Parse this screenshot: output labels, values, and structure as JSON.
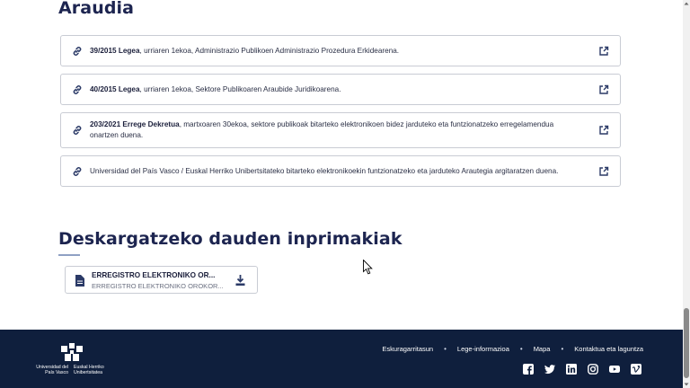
{
  "sections": {
    "regulations_title": "Araudia",
    "forms_title": "Deskargatzeko dauden inprimakiak"
  },
  "laws": [
    {
      "bold": "39/2015 Legea",
      "rest": ", urriaren 1ekoa, Administrazio Publikoen Administrazio Prozedura Erkidearena."
    },
    {
      "bold": "40/2015 Legea",
      "rest": ", urriaren 1ekoa, Sektore Publikoaren Araubide Juridikoarena."
    },
    {
      "bold": "203/2021 Errege Dekretua",
      "rest": ", martxoaren 30ekoa, sektore publikoak bitarteko elektronikoen bidez jarduteko eta funtzionatzeko erregelamendua onartzen duena."
    },
    {
      "bold": "",
      "rest": "Universidad del País Vasco / Euskal Herriko Unibertsitateko bitarteko elektronikoekin funtzionatzeko eta jarduteko Arautegia argitaratzen duena."
    }
  ],
  "download": {
    "title": "ERREGISTRO ELEKTRONIKO OR...",
    "subtitle": "ERREGISTRO ELEKTRONIKO OROKOR..."
  },
  "footer": {
    "logo_left": "Universidad del País Vasco",
    "logo_right": "Euskal Herriko Unibertsitatea",
    "links": [
      "Eskuragarritasun",
      "Lege-informazioa",
      "Mapa",
      "Kontaktua eta laguntza"
    ],
    "socials": [
      "facebook-icon",
      "twitter-icon",
      "linkedin-icon",
      "instagram-icon",
      "youtube-icon",
      "vimeo-icon"
    ]
  },
  "colors": {
    "accent": "#1d2550",
    "footer_bg": "#0f1f3d",
    "icon": "#2b3a67"
  }
}
